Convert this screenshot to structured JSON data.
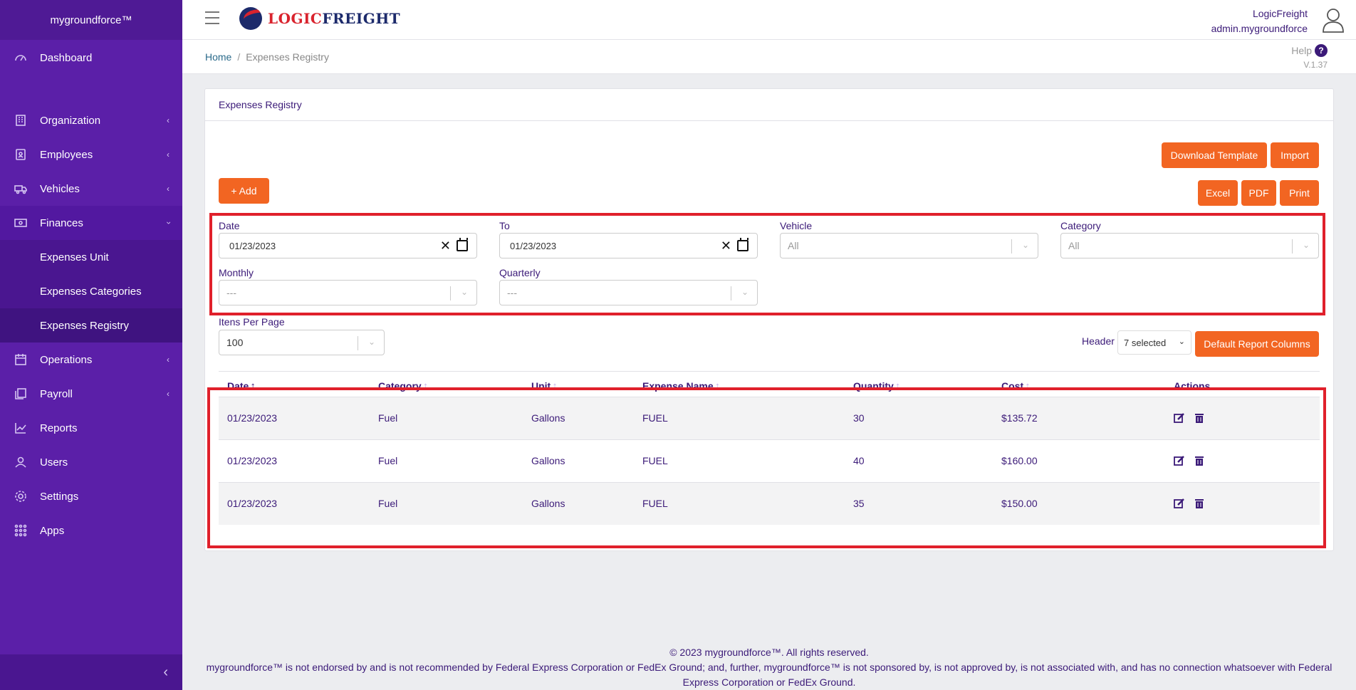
{
  "sidebar": {
    "brand": "mygroundforce™",
    "items": [
      {
        "label": "Dashboard",
        "icon": "gauge-icon"
      },
      {
        "label": "Organization",
        "icon": "building-icon"
      },
      {
        "label": "Employees",
        "icon": "badge-icon"
      },
      {
        "label": "Vehicles",
        "icon": "truck-icon"
      },
      {
        "label": "Finances",
        "icon": "money-icon"
      },
      {
        "label": "Operations",
        "icon": "calendar-icon"
      },
      {
        "label": "Payroll",
        "icon": "copy-icon"
      },
      {
        "label": "Reports",
        "icon": "chart-line-icon"
      },
      {
        "label": "Users",
        "icon": "user-icon"
      },
      {
        "label": "Settings",
        "icon": "gear-icon"
      },
      {
        "label": "Apps",
        "icon": "grid-icon"
      }
    ],
    "sub_items": [
      "Expenses Unit",
      "Expenses Categories",
      "Expenses Registry"
    ],
    "collapse_glyph": "‹"
  },
  "header": {
    "logo_part1": "LOGIC",
    "logo_part2": "FREIGHT",
    "company": "LogicFreight",
    "username": "admin.mygroundforce"
  },
  "breadcrumb": {
    "home": "Home",
    "separator": "/",
    "current": "Expenses Registry",
    "help": "Help",
    "help_glyph": "?",
    "version": "V.1.37"
  },
  "card": {
    "title": "Expenses Registry",
    "buttons": {
      "download_template": "Download Template",
      "import": "Import",
      "add": "+ Add",
      "excel": "Excel",
      "pdf": "PDF",
      "print": "Print",
      "default_report_columns": "Default Report Columns"
    }
  },
  "filters": {
    "date_label": "Date",
    "date_value": "01/23/2023",
    "to_label": "To",
    "to_value": "01/23/2023",
    "vehicle_label": "Vehicle",
    "vehicle_value": "All",
    "category_label": "Category",
    "category_value": "All",
    "monthly_label": "Monthly",
    "monthly_value": "---",
    "quarterly_label": "Quarterly",
    "quarterly_value": "---",
    "clear_glyph": "✕"
  },
  "paging": {
    "items_per_page_label": "Itens Per Page",
    "items_per_page_value": "100",
    "header_label": "Header",
    "header_value": "7 selected"
  },
  "table": {
    "columns": [
      "Date",
      "Category",
      "Unit",
      "Expense Name",
      "Quantity",
      "Cost",
      "Actions"
    ],
    "sort_glyph": "↑",
    "rows": [
      {
        "date": "01/23/2023",
        "category": "Fuel",
        "unit": "Gallons",
        "name": "FUEL",
        "quantity": "30",
        "cost": "$135.72"
      },
      {
        "date": "01/23/2023",
        "category": "Fuel",
        "unit": "Gallons",
        "name": "FUEL",
        "quantity": "40",
        "cost": "$160.00"
      },
      {
        "date": "01/23/2023",
        "category": "Fuel",
        "unit": "Gallons",
        "name": "FUEL",
        "quantity": "35",
        "cost": "$150.00"
      }
    ]
  },
  "footer": {
    "copyright": "© 2023 mygroundforce™. All rights reserved.",
    "disclaimer_line1": "mygroundforce™ is not endorsed by and is not recommended by Federal Express Corporation or FedEx Ground; and, further, mygroundforce™ is not sponsored by, is not approved by, is not associated with, and has no connection whatsoever with Federal",
    "disclaimer_line2": "Express Corporation or FedEx Ground."
  },
  "colors": {
    "sidebar": "#5b1fa8",
    "accent": "#f26522",
    "text": "#3b1a78",
    "highlight_box": "#e0202b"
  }
}
